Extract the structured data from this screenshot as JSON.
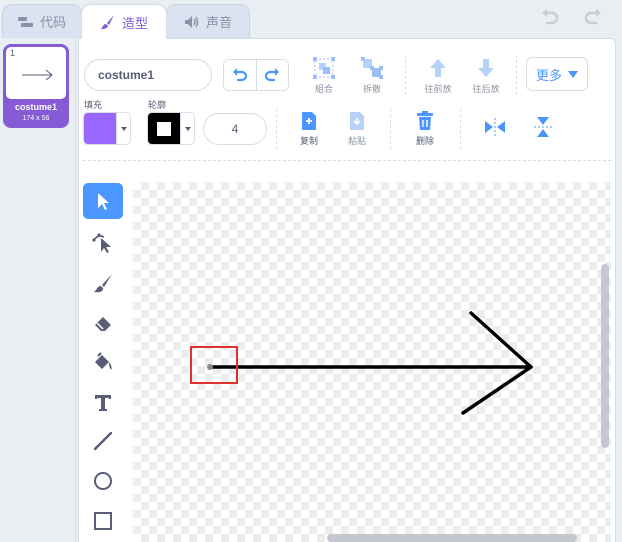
{
  "tabs": [
    {
      "label": "代码",
      "icon": "code-blocks-icon"
    },
    {
      "label": "造型",
      "icon": "paintbrush-icon"
    },
    {
      "label": "声音",
      "icon": "speaker-icon"
    }
  ],
  "costume": {
    "number": "1",
    "name": "costume1",
    "size": "174 x 56"
  },
  "editor": {
    "costume_name_value": "costume1",
    "toolbar": {
      "group_label": "組合",
      "ungroup_label": "拆散",
      "forward_label": "往前放",
      "backward_label": "往后放",
      "more_label": "更多",
      "copy_label": "复制",
      "paste_label": "粘贴",
      "delete_label": "删除"
    },
    "fill_label": "填充",
    "outline_label": "轮廓",
    "stroke_width": "4",
    "fill_color": "#9966ff",
    "outline_color": "#000000"
  },
  "colors": {
    "accent": "#855cd6",
    "selected_tool": "#4c97ff",
    "highlight": "#e03030"
  }
}
